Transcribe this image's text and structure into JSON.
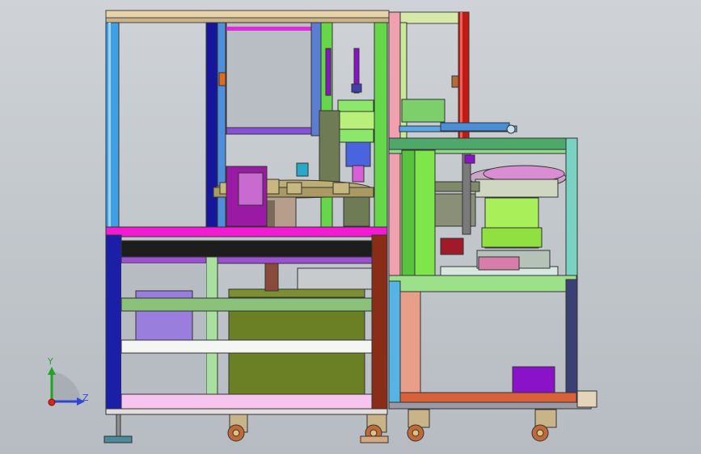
{
  "view": {
    "kind": "cad-assembly-viewport",
    "background": "#c6cbd0"
  },
  "triad": {
    "y_label": "Y",
    "z_label": "Z",
    "y_color": "#21a326",
    "z_color": "#2f46d8",
    "x_color": "#d9261c"
  },
  "colors": {
    "frame_blue": "#3fa0e6",
    "frame_navy": "#16169a",
    "frame_green": "#66d64a",
    "frame_red": "#c21a12",
    "frame_brown": "#8a2d16",
    "band_magenta": "#f21ad2",
    "plate_olive": "#6b7f24",
    "feeder_green": "#a9ef5a",
    "accent_purple": "#8a12c8"
  }
}
